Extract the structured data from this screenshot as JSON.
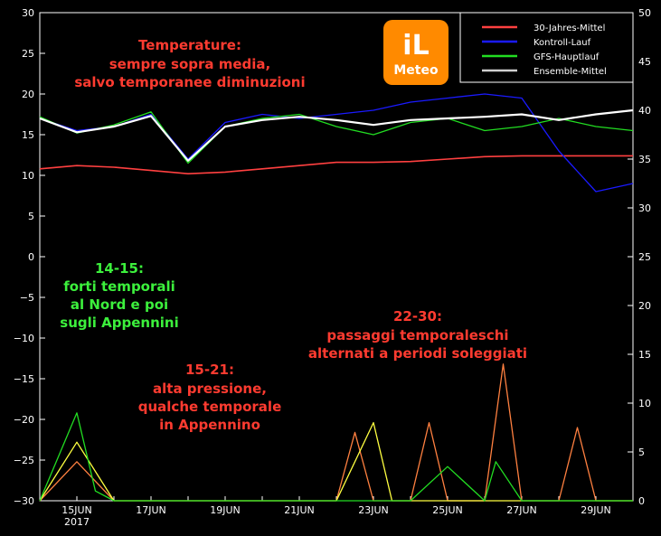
{
  "chart_data": {
    "type": "line",
    "title": "",
    "xlabel": "",
    "ylabel": "",
    "x_tick_labels": [
      "15JUN",
      "17JUN",
      "19JUN",
      "21JUN",
      "23JUN",
      "25JUN",
      "27JUN",
      "29JUN"
    ],
    "x_year_label": "2017",
    "xlim": [
      "2017-06-14",
      "2017-06-30"
    ],
    "y_left_lim": [
      -30,
      30
    ],
    "y_left_ticks": [
      -30,
      -25,
      -20,
      -15,
      -10,
      -5,
      0,
      5,
      10,
      15,
      20,
      25,
      30
    ],
    "y_right_lim": [
      0,
      50
    ],
    "y_right_ticks": [
      0,
      5,
      10,
      15,
      20,
      25,
      30,
      35,
      40,
      45,
      50
    ],
    "grid": false,
    "legend_position": "top-right",
    "legend": [
      {
        "name": "30-Jahres-Mittel",
        "color": "#ff4040"
      },
      {
        "name": "Kontroll-Lauf",
        "color": "#1a1aff"
      },
      {
        "name": "GFS-Hauptlauf",
        "color": "#22dd22"
      },
      {
        "name": "Ensemble-Mittel",
        "color": "#cfcfcf"
      }
    ],
    "series": [
      {
        "name": "30-Jahres-Mittel",
        "axis": "left",
        "color": "#ff4040",
        "x": [
          "2017-06-14",
          "2017-06-15",
          "2017-06-16",
          "2017-06-17",
          "2017-06-18",
          "2017-06-19",
          "2017-06-20",
          "2017-06-21",
          "2017-06-22",
          "2017-06-23",
          "2017-06-24",
          "2017-06-25",
          "2017-06-26",
          "2017-06-27",
          "2017-06-28",
          "2017-06-29",
          "2017-06-30"
        ],
        "y": [
          10.8,
          11.2,
          11.0,
          10.6,
          10.2,
          10.4,
          10.8,
          11.2,
          11.6,
          11.6,
          11.7,
          12.0,
          12.3,
          12.4,
          12.4,
          12.4,
          12.4
        ]
      },
      {
        "name": "Kontroll-Lauf",
        "axis": "left",
        "color": "#1a1aff",
        "x": [
          "2017-06-14",
          "2017-06-15",
          "2017-06-16",
          "2017-06-17",
          "2017-06-18",
          "2017-06-19",
          "2017-06-20",
          "2017-06-21",
          "2017-06-22",
          "2017-06-23",
          "2017-06-24",
          "2017-06-25",
          "2017-06-26",
          "2017-06-27",
          "2017-06-28",
          "2017-06-29",
          "2017-06-30"
        ],
        "y": [
          17.0,
          15.5,
          16.0,
          17.5,
          12.0,
          16.5,
          17.5,
          17.0,
          17.5,
          18.0,
          19.0,
          19.5,
          20.0,
          19.5,
          13.0,
          8.0,
          9.0
        ]
      },
      {
        "name": "GFS-Hauptlauf",
        "axis": "left",
        "color": "#22dd22",
        "x": [
          "2017-06-14",
          "2017-06-15",
          "2017-06-16",
          "2017-06-17",
          "2017-06-18",
          "2017-06-19",
          "2017-06-20",
          "2017-06-21",
          "2017-06-22",
          "2017-06-23",
          "2017-06-24",
          "2017-06-25",
          "2017-06-26",
          "2017-06-27",
          "2017-06-28",
          "2017-06-29",
          "2017-06-30"
        ],
        "y": [
          17.2,
          15.2,
          16.2,
          17.8,
          11.5,
          16.0,
          17.0,
          17.5,
          16.0,
          15.0,
          16.5,
          17.0,
          15.5,
          16.0,
          17.0,
          16.0,
          15.5
        ]
      },
      {
        "name": "Ensemble-Mittel",
        "axis": "left",
        "color": "#ffffff",
        "x": [
          "2017-06-14",
          "2017-06-15",
          "2017-06-16",
          "2017-06-17",
          "2017-06-18",
          "2017-06-19",
          "2017-06-20",
          "2017-06-21",
          "2017-06-22",
          "2017-06-23",
          "2017-06-24",
          "2017-06-25",
          "2017-06-26",
          "2017-06-27",
          "2017-06-28",
          "2017-06-29",
          "2017-06-30"
        ],
        "y": [
          17.0,
          15.3,
          16.0,
          17.3,
          11.8,
          16.0,
          16.8,
          17.2,
          16.8,
          16.2,
          16.8,
          17.0,
          17.2,
          17.5,
          16.8,
          17.5,
          18.0
        ]
      },
      {
        "name": "precip-1",
        "axis": "right",
        "color": "#ff8040",
        "x": [
          "2017-06-14",
          "2017-06-15",
          "2017-06-16",
          "2017-06-20",
          "2017-06-21",
          "2017-06-22",
          "2017-06-22.5",
          "2017-06-23",
          "2017-06-24",
          "2017-06-24.5",
          "2017-06-25",
          "2017-06-26",
          "2017-06-26.5",
          "2017-06-27",
          "2017-06-28",
          "2017-06-28.5",
          "2017-06-29",
          "2017-06-30"
        ],
        "y": [
          0,
          4,
          0,
          0,
          0,
          0,
          7,
          0,
          0,
          8,
          0,
          0,
          14,
          0,
          0,
          7.5,
          0,
          0
        ]
      },
      {
        "name": "precip-2",
        "axis": "right",
        "color": "#ffff40",
        "x": [
          "2017-06-14",
          "2017-06-15",
          "2017-06-16",
          "2017-06-22",
          "2017-06-23",
          "2017-06-23.5",
          "2017-06-24",
          "2017-06-30"
        ],
        "y": [
          0,
          6,
          0,
          0,
          8,
          0,
          0,
          0
        ]
      },
      {
        "name": "precip-3",
        "axis": "right",
        "color": "#22dd22",
        "x": [
          "2017-06-14",
          "2017-06-15",
          "2017-06-15.5",
          "2017-06-16",
          "2017-06-24",
          "2017-06-25",
          "2017-06-26",
          "2017-06-26.3",
          "2017-06-27",
          "2017-06-30"
        ],
        "y": [
          0,
          9,
          1,
          0,
          0,
          3.5,
          0,
          4,
          0,
          0
        ]
      }
    ]
  },
  "logo": {
    "brand": "iL",
    "name": "Meteo",
    "bg_color": "#ff8a00"
  },
  "annotations": {
    "temp_title": "Temperature:",
    "temp_line1": "sempre sopra media,",
    "temp_line2": "salvo temporanee diminuzioni",
    "storm_line1": "14-15:",
    "storm_line2": "forti temporali",
    "storm_line3": "al Nord e poi",
    "storm_line4": "sugli Appennini",
    "high_line1": "15-21:",
    "high_line2": "alta pressione,",
    "high_line3": "qualche temporale",
    "high_line4": "in Appennino",
    "late_line1": "22-30:",
    "late_line2": "passaggi temporaleschi",
    "late_line3": "alternati a periodi soleggiati"
  }
}
